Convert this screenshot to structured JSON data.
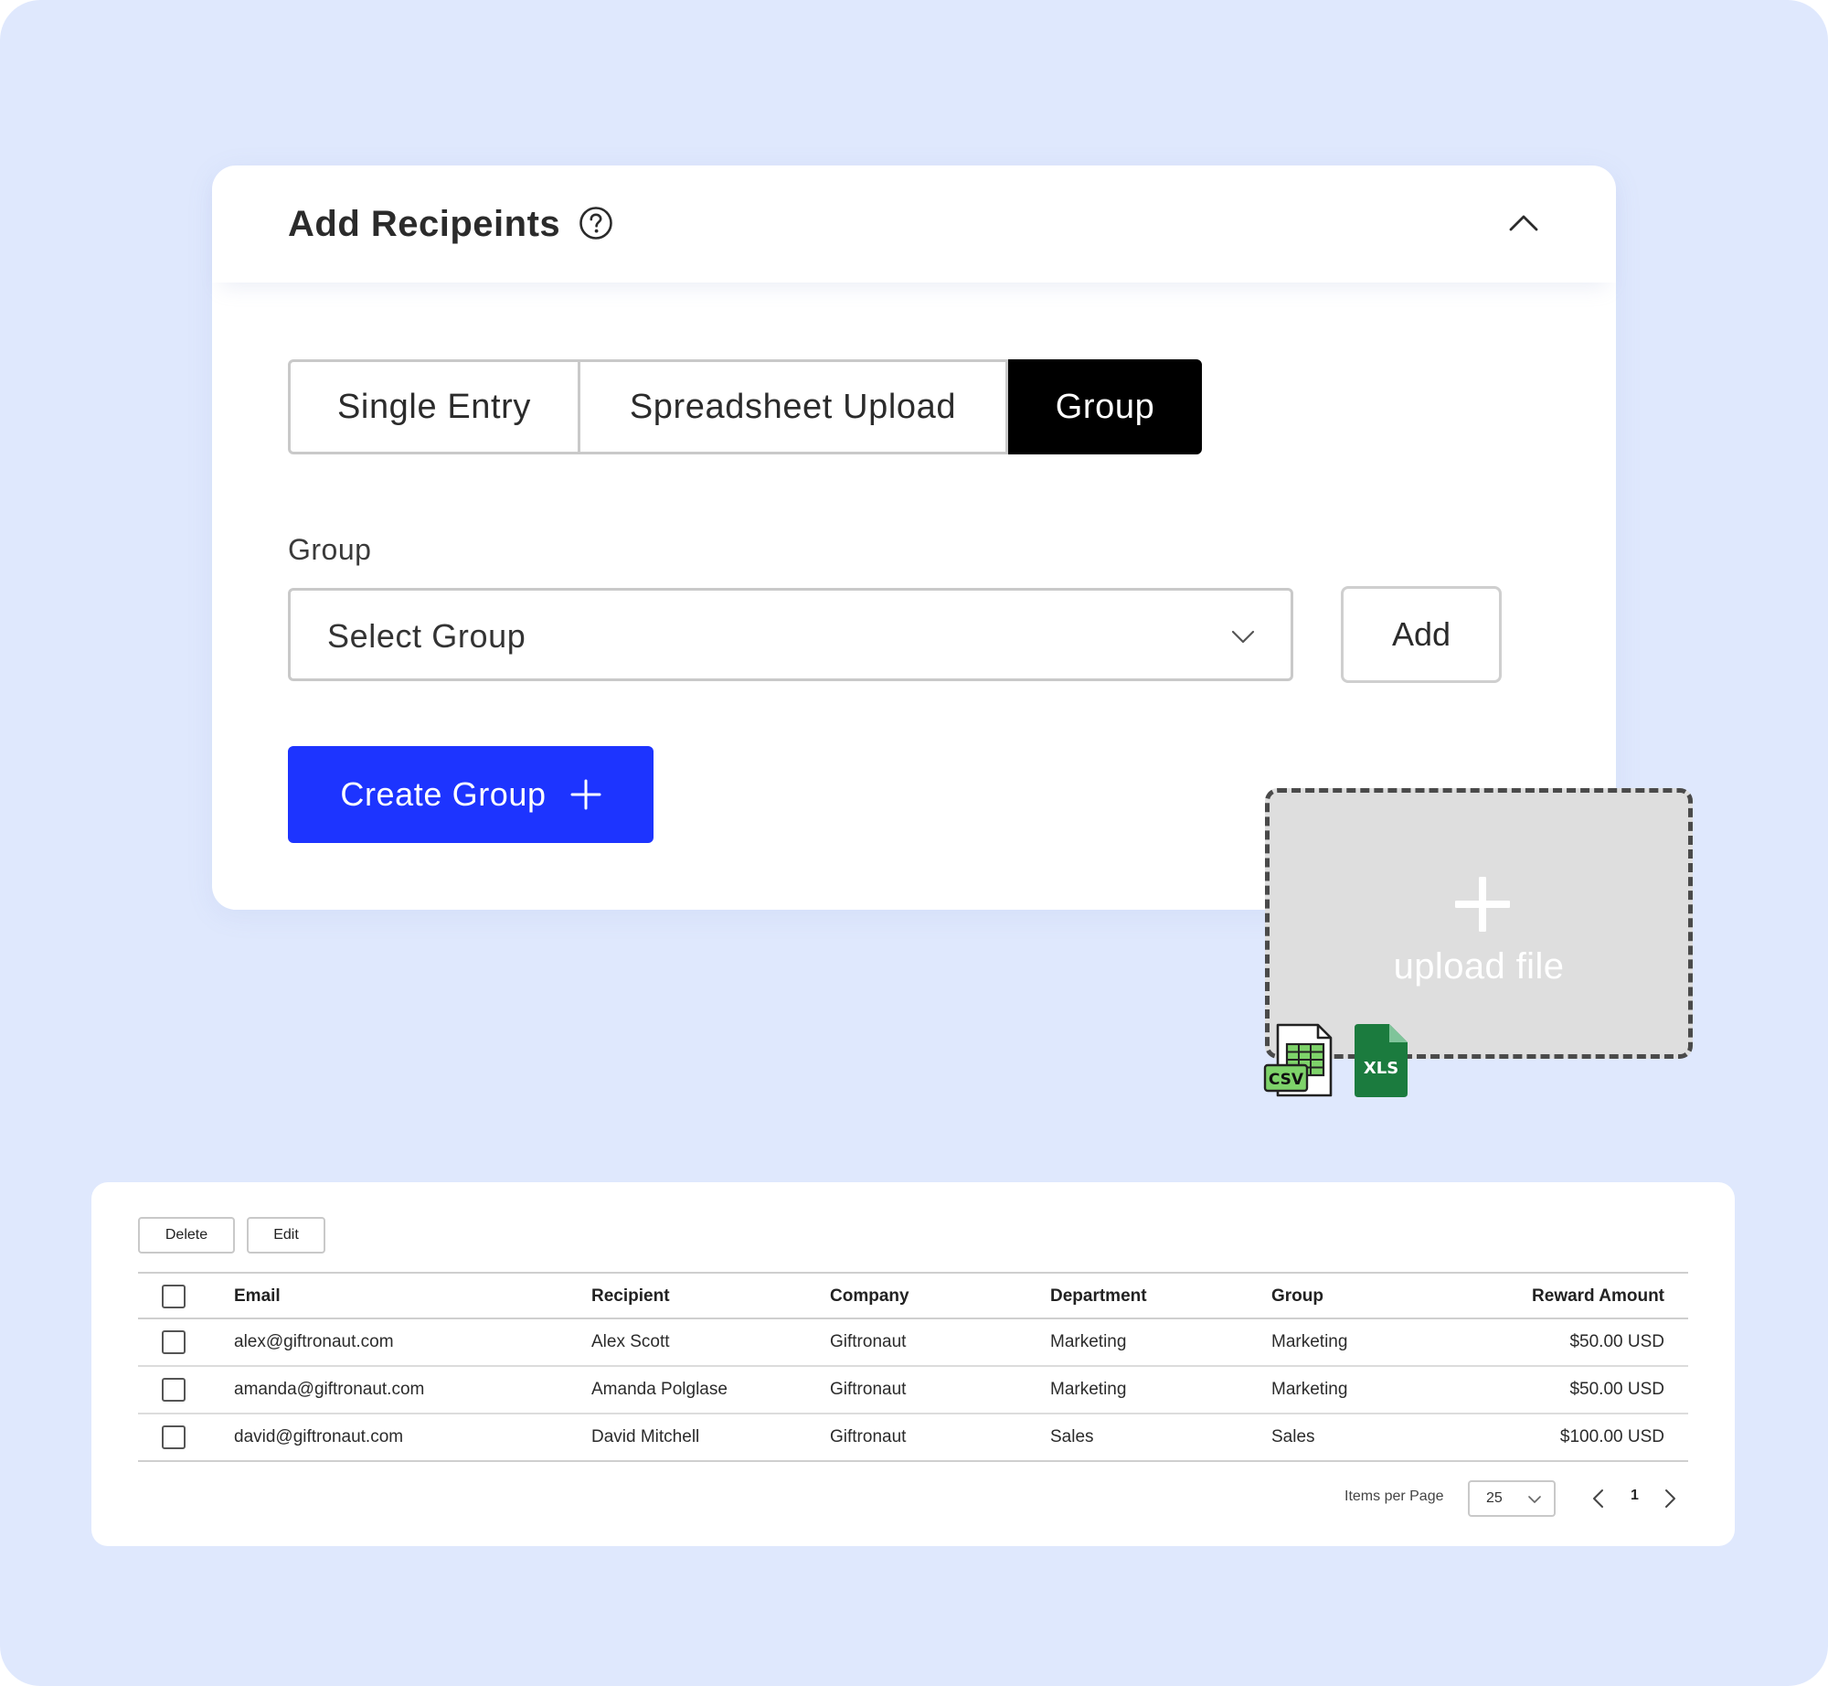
{
  "card": {
    "title": "Add Recipeints",
    "tabs": [
      {
        "label": "Single Entry",
        "active": false
      },
      {
        "label": "Spreadsheet Upload",
        "active": false
      },
      {
        "label": "Group",
        "active": true
      }
    ],
    "group_label": "Group",
    "select_placeholder": "Select Group",
    "add_label": "Add",
    "create_group_label": "Create Group",
    "accent_color": "#1d34ff"
  },
  "upload": {
    "text": "upload file",
    "file_types": [
      "CSV",
      "XLS"
    ]
  },
  "table": {
    "delete_label": "Delete",
    "edit_label": "Edit",
    "columns": [
      "Email",
      "Recipient",
      "Company",
      "Department",
      "Group",
      "Reward Amount"
    ],
    "rows": [
      {
        "email": "alex@giftronaut.com",
        "recipient": "Alex Scott",
        "company": "Giftronaut",
        "department": "Marketing",
        "group": "Marketing",
        "amount": "$50.00 USD"
      },
      {
        "email": "amanda@giftronaut.com",
        "recipient": "Amanda Polglase",
        "company": "Giftronaut",
        "department": "Marketing",
        "group": "Marketing",
        "amount": "$50.00 USD"
      },
      {
        "email": "david@giftronaut.com",
        "recipient": "David Mitchell",
        "company": "Giftronaut",
        "department": "Sales",
        "group": "Sales",
        "amount": "$100.00 USD"
      }
    ],
    "pagination": {
      "items_per_page_label": "Items per Page",
      "items_per_page": "25",
      "current_page": "1"
    }
  }
}
